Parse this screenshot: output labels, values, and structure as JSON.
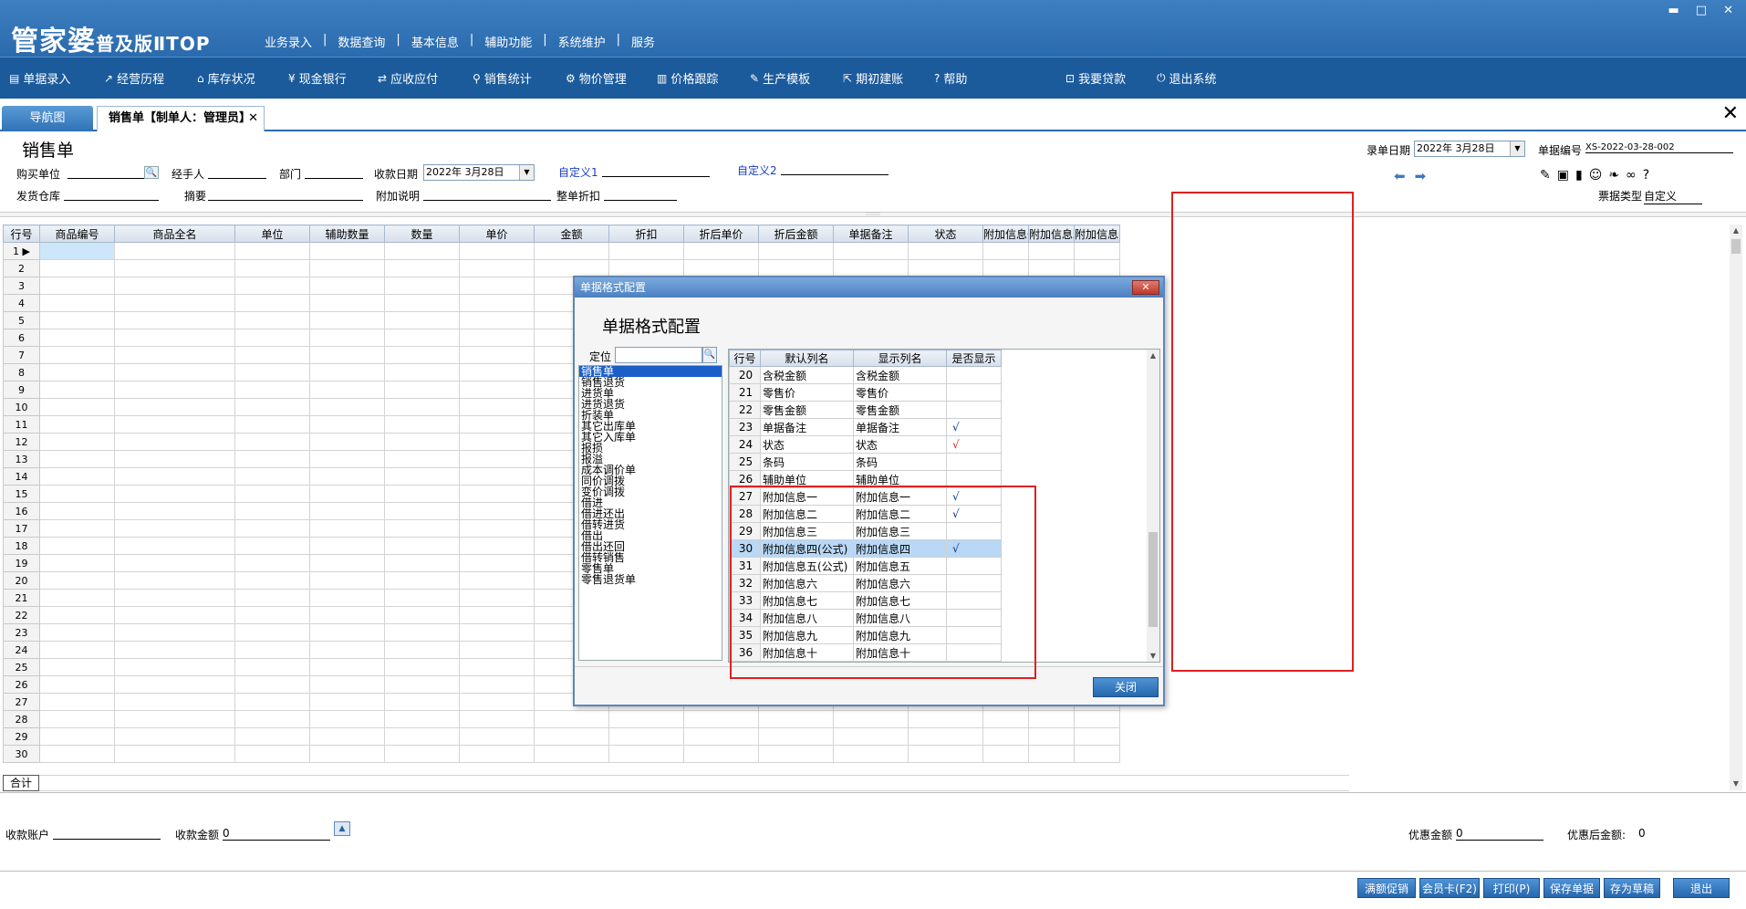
{
  "app": {
    "logo": "管家婆",
    "logo_edition": "普及版ⅡTOP",
    "top_menu": [
      "业务录入",
      "数据查询",
      "基本信息",
      "辅助功能",
      "系统维护",
      "服务"
    ],
    "window_controls": [
      "▬",
      "□",
      "✕"
    ]
  },
  "toolbar": [
    {
      "icon": "document-icon",
      "glyph": "▤",
      "label": "单据录入"
    },
    {
      "icon": "chart-icon",
      "glyph": "↗",
      "label": "经营历程"
    },
    {
      "icon": "home-icon",
      "glyph": "⌂",
      "label": "库存状况"
    },
    {
      "icon": "yen-icon",
      "glyph": "¥",
      "label": "现金银行"
    },
    {
      "icon": "exchange-icon",
      "glyph": "⇄",
      "label": "应收应付"
    },
    {
      "icon": "search-icon",
      "glyph": "⚲",
      "label": "销售统计"
    },
    {
      "icon": "gear-icon",
      "glyph": "⚙",
      "label": "物价管理"
    },
    {
      "icon": "bar-chart-icon",
      "glyph": "▥",
      "label": "价格跟踪"
    },
    {
      "icon": "wrench-icon",
      "glyph": "✎",
      "label": "生产模板"
    },
    {
      "icon": "export-icon",
      "glyph": "⇱",
      "label": "期初建账"
    },
    {
      "icon": "help-icon",
      "glyph": "?",
      "label": "帮助"
    },
    {
      "icon": "lock-icon",
      "glyph": "⊡",
      "label": "我要贷款"
    },
    {
      "icon": "power-icon",
      "glyph": "⏻",
      "label": "退出系统"
    }
  ],
  "tabs": {
    "nav": "导航图",
    "doc": "销售单【制单人：管理员】",
    "close": "✕",
    "main_close": "✕"
  },
  "form": {
    "title": "销售单",
    "buyer": "购买单位",
    "handler": "经手人",
    "dept": "部门",
    "pay_date_label": "收款日期",
    "pay_date": "2022年 3月28日",
    "custom1": "自定义1",
    "custom2": "自定义2",
    "warehouse": "发货仓库",
    "summary": "摘要",
    "extra_note": "附加说明",
    "discount": "整单折扣",
    "entry_date_label": "录单日期",
    "entry_date": "2022年 3月28日",
    "doc_no_label": "单据编号",
    "doc_no": "XS-2022-03-28-002",
    "ticket_type_label": "票据类型",
    "ticket_type": "自定义",
    "dd_arrow": "▼",
    "search_glyph": "🔍",
    "arrow_left": "⬅",
    "arrow_right": "➡"
  },
  "right_icons": [
    {
      "icon": "edit-icon",
      "glyph": "✎"
    },
    {
      "icon": "box-icon",
      "glyph": "▣"
    },
    {
      "icon": "book-icon",
      "glyph": "▮"
    },
    {
      "icon": "user-icon",
      "glyph": "☺"
    },
    {
      "icon": "leaf-icon",
      "glyph": "❧"
    },
    {
      "icon": "link-icon",
      "glyph": "∞"
    },
    {
      "icon": "help-icon",
      "glyph": "?"
    }
  ],
  "grid": {
    "columns": [
      "行号",
      "商品编号",
      "商品全名",
      "单位",
      "辅助数量",
      "数量",
      "单价",
      "金额",
      "折扣",
      "折后单价",
      "折后金额",
      "单据备注",
      "状态",
      "附加信息一",
      "附加信息二",
      "附加信息四"
    ],
    "row_count": 30,
    "total_label": "合计"
  },
  "footer": {
    "account": "收款账户",
    "amount": "收款金额",
    "amount_value": "0",
    "discount_amt": "优惠金额",
    "discount_amt_value": "0",
    "after_discount": "优惠后金额:",
    "after_discount_value": "0",
    "up_glyph": "▲"
  },
  "buttons": [
    "满额促销",
    "会员卡(F2)",
    "打印(P)",
    "保存单据",
    "存为草稿",
    "退出"
  ],
  "dialog": {
    "title": "单据格式配置",
    "close_glyph": "✕",
    "heading": "单据格式配置",
    "find_label": "定位",
    "find_glyph": "🔍",
    "list": [
      "销售单",
      "销售退货",
      "进货单",
      "进货退货",
      "折装单",
      "其它出库单",
      "其它入库单",
      "报损",
      "报溢",
      "成本调价单",
      "同价调拨",
      "变价调拨",
      "借进",
      "借进还出",
      "借转进货",
      "借出",
      "借出还回",
      "借转销售",
      "零售单",
      "零售退货单"
    ],
    "columns": [
      "行号",
      "默认列名",
      "显示列名",
      "是否显示"
    ],
    "rows": [
      {
        "no": "20",
        "default": "含税金额",
        "display": "含税金额",
        "show": ""
      },
      {
        "no": "21",
        "default": "零售价",
        "display": "零售价",
        "show": ""
      },
      {
        "no": "22",
        "default": "零售金额",
        "display": "零售金额",
        "show": ""
      },
      {
        "no": "23",
        "default": "单据备注",
        "display": "单据备注",
        "show": "√"
      },
      {
        "no": "24",
        "default": "状态",
        "display": "状态",
        "show": "√"
      },
      {
        "no": "25",
        "default": "条码",
        "display": "条码",
        "show": ""
      },
      {
        "no": "26",
        "default": "辅助单位",
        "display": "辅助单位",
        "show": ""
      },
      {
        "no": "27",
        "default": "附加信息一",
        "display": "附加信息一",
        "show": "√"
      },
      {
        "no": "28",
        "default": "附加信息二",
        "display": "附加信息二",
        "show": "√"
      },
      {
        "no": "29",
        "default": "附加信息三",
        "display": "附加信息三",
        "show": ""
      },
      {
        "no": "30",
        "default": "附加信息四(公式)",
        "display": "附加信息四",
        "show": "√"
      },
      {
        "no": "31",
        "default": "附加信息五(公式)",
        "display": "附加信息五",
        "show": ""
      },
      {
        "no": "32",
        "default": "附加信息六",
        "display": "附加信息六",
        "show": ""
      },
      {
        "no": "33",
        "default": "附加信息七",
        "display": "附加信息七",
        "show": ""
      },
      {
        "no": "34",
        "default": "附加信息八",
        "display": "附加信息八",
        "show": ""
      },
      {
        "no": "35",
        "default": "附加信息九",
        "display": "附加信息九",
        "show": ""
      },
      {
        "no": "36",
        "default": "附加信息十",
        "display": "附加信息十",
        "show": ""
      }
    ],
    "close_button": "关闭",
    "selected_row": "30",
    "scroll_up": "▲",
    "scroll_down": "▼"
  },
  "colors": {
    "accent": "#2a6aae",
    "highlight": "#e02020",
    "check_blue": "#003399"
  }
}
